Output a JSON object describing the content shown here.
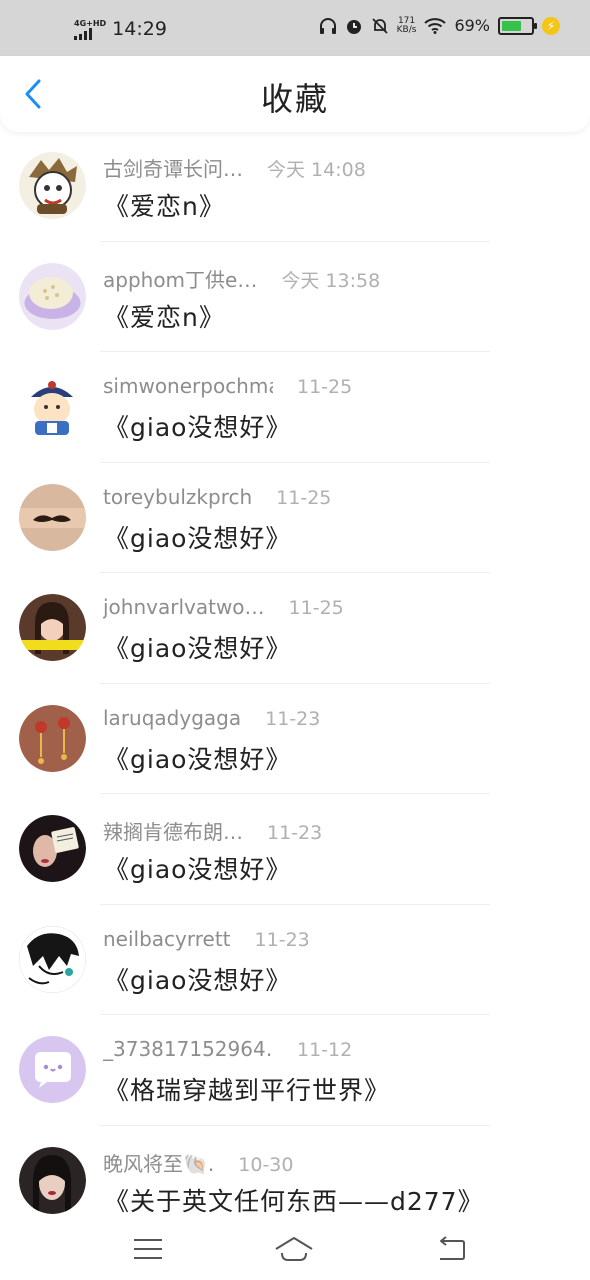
{
  "status_bar": {
    "network_top": "4G+HD",
    "time": "14:29",
    "speed_top": "171",
    "speed_unit": "KB/s",
    "battery": "69%",
    "battery_level": 0.69,
    "colors": {
      "battery_fill": "#35c24a",
      "bolt": "#f5c518"
    }
  },
  "header": {
    "title": "收藏",
    "back_icon": "chevron-left-icon",
    "accent_color": "#1a8ef2"
  },
  "favorites": [
    {
      "author": "古剑奇谭长问…",
      "time": "今天 14:08",
      "content": "《爱恋n》",
      "avatar": "cartoon-warrior"
    },
    {
      "author": "apphom丁供e…",
      "time": "今天 13:58",
      "content": "《爱恋n》",
      "avatar": "bowl-of-food"
    },
    {
      "author": "simwonerpochma",
      "time": "11-25",
      "content": "《giao没想好》",
      "avatar": "cartoon-qing-official"
    },
    {
      "author": "toreybulzkprch",
      "time": "11-25",
      "content": "《giao没想好》",
      "avatar": "mustache-finger"
    },
    {
      "author": "johnvarlvatwo…",
      "time": "11-25",
      "content": "《giao没想好》",
      "avatar": "girl-photo"
    },
    {
      "author": "laruqadygaga",
      "time": "11-23",
      "content": "《giao没想好》",
      "avatar": "red-earrings"
    },
    {
      "author": "辣搁肯德布朗…",
      "time": "11-23",
      "content": "《giao没想好》",
      "avatar": "girl-with-note"
    },
    {
      "author": "neilbacyrrett",
      "time": "11-23",
      "content": "《giao没想好》",
      "avatar": "ink-sketch-face"
    },
    {
      "author": "_373817152964…",
      "time": "11-12",
      "content": "《格瑞穿越到平行世界》",
      "avatar": "purple-chat-bubble"
    },
    {
      "author": "晚风将至🐚.",
      "time": "10-30",
      "content": "《关于英文任何东西——d277》",
      "avatar": "dark-hair-girl"
    }
  ],
  "nav_bar": {
    "menu_icon": "menu-icon",
    "home_icon": "home-icon",
    "back_icon": "back-arrow-icon"
  }
}
